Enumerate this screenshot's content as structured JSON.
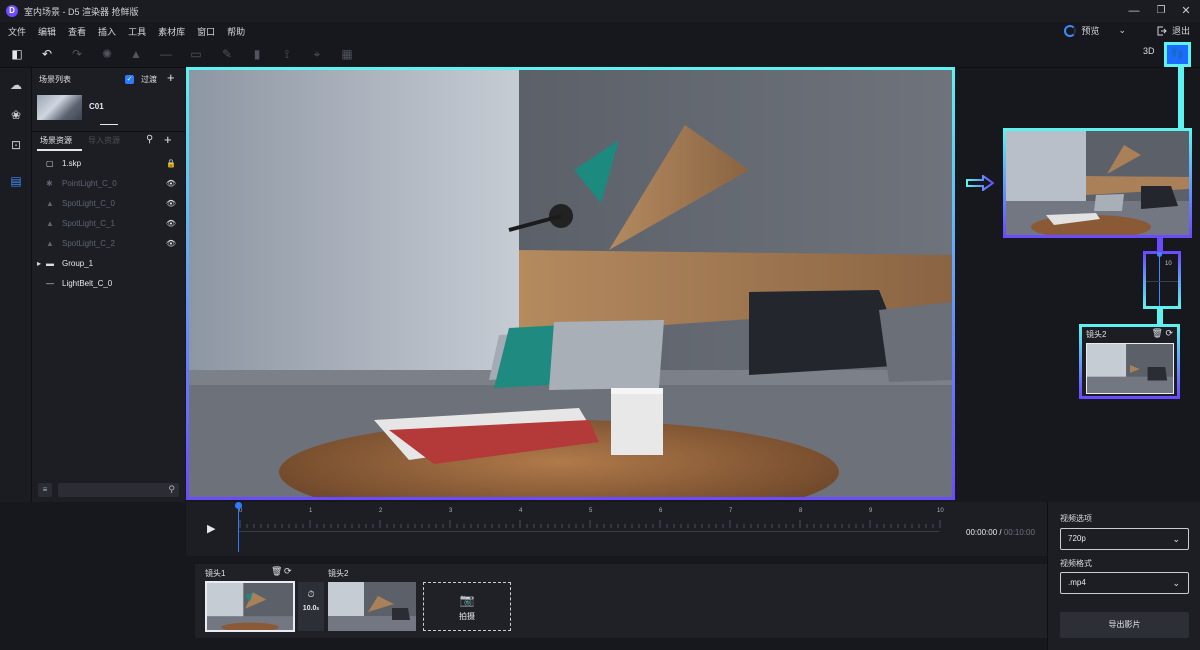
{
  "titlebar": {
    "logo": "D",
    "title": "室内场景 - D5 渲染器 抢鲜版",
    "min": "—",
    "restore": "❐",
    "close": "✕"
  },
  "menu": [
    "文件",
    "编辑",
    "查看",
    "插入",
    "工具",
    "素材库",
    "窗口",
    "帮助"
  ],
  "topright": {
    "preview_label": "预览",
    "preview_chevron": "⌄",
    "exit_label": "退出",
    "mode_3d": "3D"
  },
  "scene_panel": {
    "header": "场景列表",
    "filter_label": "过渡",
    "scene_name": "C01",
    "tabs": {
      "assets": "场景资源",
      "import": "导入资源"
    },
    "resources": [
      {
        "icon": "▢",
        "label": "1.skp",
        "right": "🔒",
        "dim": false
      },
      {
        "icon": "✱",
        "label": "PointLight_C_0",
        "right": "👁",
        "dim": true
      },
      {
        "icon": "▲",
        "label": "SpotLight_C_0",
        "right": "👁",
        "dim": true
      },
      {
        "icon": "▲",
        "label": "SpotLight_C_1",
        "right": "👁",
        "dim": true
      },
      {
        "icon": "▲",
        "label": "SpotLight_C_2",
        "right": "👁",
        "dim": true
      },
      {
        "icon": "▸",
        "label": "Group_1",
        "right": "",
        "dim": false
      },
      {
        "icon": "—",
        "label": "LightBelt_C_0",
        "right": "",
        "dim": false
      }
    ]
  },
  "camera_map": {
    "mini_value": "10",
    "small_label": "镜头2"
  },
  "timeline": {
    "ticks": [
      "0",
      "1",
      "2",
      "3",
      "4",
      "5",
      "6",
      "7",
      "8",
      "9",
      "10"
    ],
    "current_time": "00:00:00",
    "separator": " / ",
    "total_time": "00:10:00"
  },
  "shots": {
    "items": [
      {
        "label": "镜头1"
      },
      {
        "label": "镜头2"
      }
    ],
    "transition_value": "10.0",
    "transition_unit": "s",
    "add_label": "拍摄"
  },
  "export": {
    "video_option_label": "视频选项",
    "resolution": "720p",
    "format_label": "视频格式",
    "format": ".mp4",
    "export_button": "导出影片"
  },
  "colors": {
    "accent_blue": "#1e6bff",
    "cyan": "#5ef2f0",
    "purple": "#6a4bff",
    "bg": "#16181d"
  }
}
